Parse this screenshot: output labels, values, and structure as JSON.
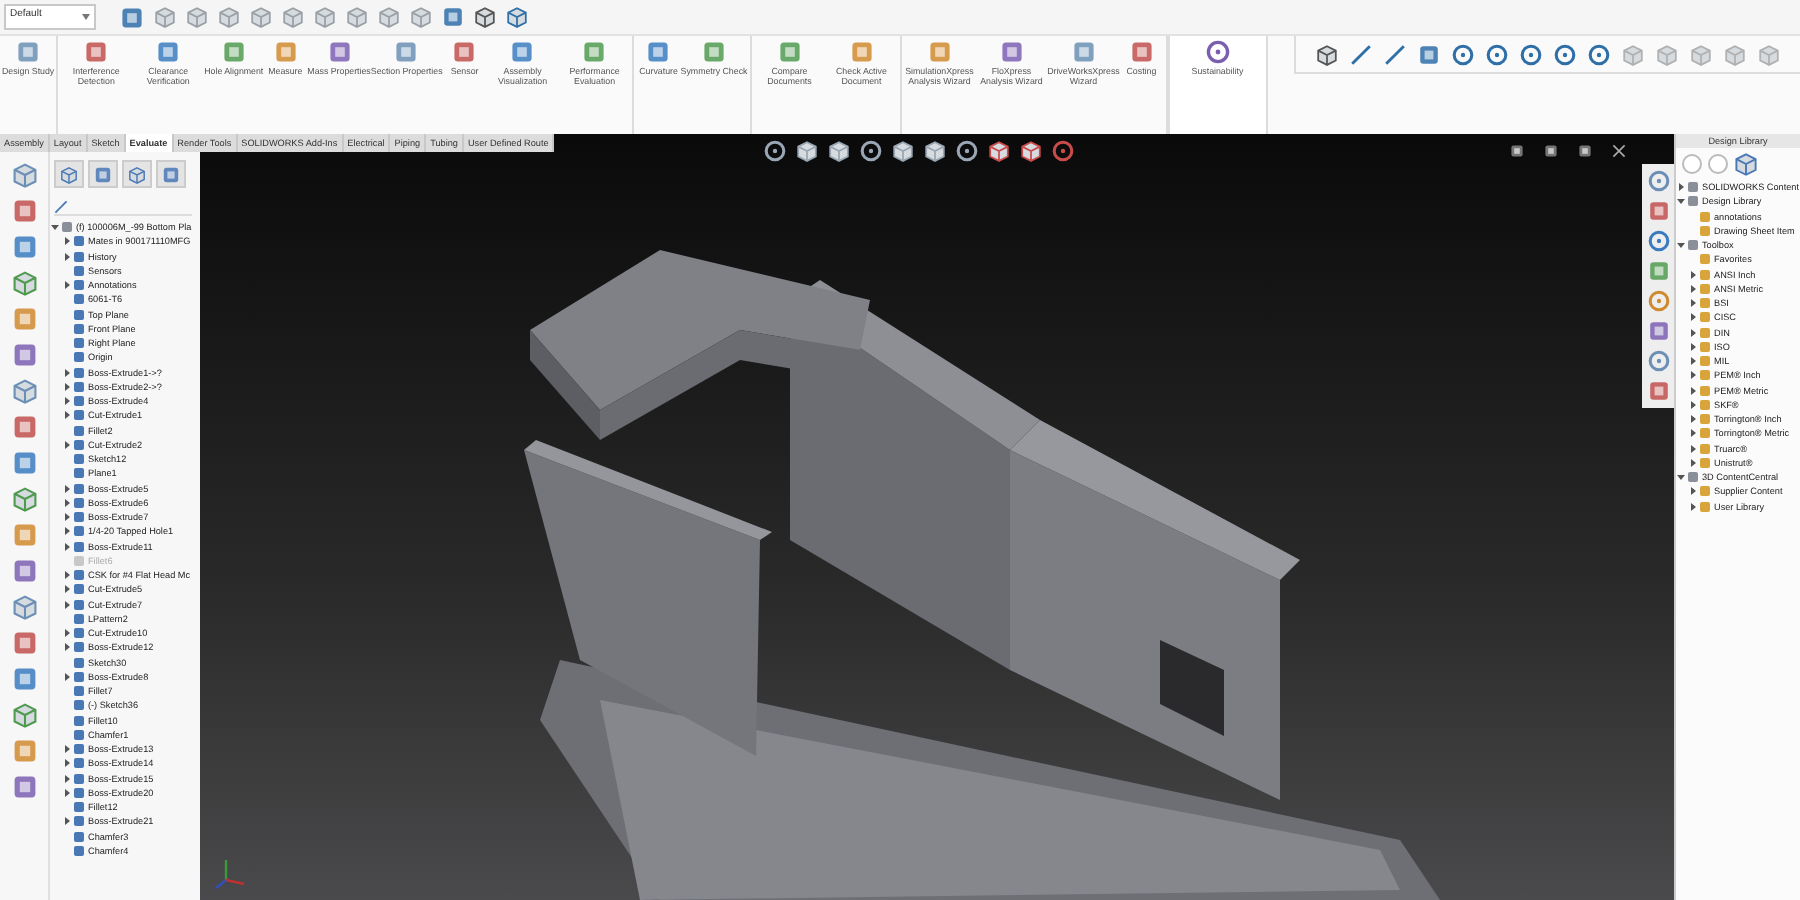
{
  "config_selector": {
    "value": "Default"
  },
  "ribbon": {
    "groups": [
      {
        "highlighted": false,
        "commands": [
          "Design Study"
        ]
      },
      {
        "highlighted": false,
        "commands": [
          "Interference Detection",
          "Clearance Verification",
          "Hole Alignment",
          "Measure",
          "Mass Properties",
          "Section Properties",
          "Sensor",
          "Assembly Visualization",
          "Performance Evaluation"
        ]
      },
      {
        "highlighted": false,
        "commands": [
          "Curvature",
          "Symmetry Check"
        ]
      },
      {
        "highlighted": false,
        "commands": [
          "Compare Documents",
          "Check Active Document"
        ]
      },
      {
        "highlighted": false,
        "commands": [
          "SimulationXpress Analysis Wizard",
          "FloXpress Analysis Wizard",
          "DriveWorksXpress Wizard",
          "Costing"
        ]
      },
      {
        "highlighted": true,
        "commands": [
          "Sustainability"
        ]
      }
    ]
  },
  "command_tabs": [
    {
      "label": "Assembly",
      "selected": false
    },
    {
      "label": "Layout",
      "selected": false
    },
    {
      "label": "Sketch",
      "selected": false
    },
    {
      "label": "Evaluate",
      "selected": true
    },
    {
      "label": "Render Tools",
      "selected": false
    },
    {
      "label": "SOLIDWORKS Add-Ins",
      "selected": false
    },
    {
      "label": "Electrical",
      "selected": false
    },
    {
      "label": "Piping",
      "selected": false
    },
    {
      "label": "Tubing",
      "selected": false
    },
    {
      "label": "User Defined Route",
      "selected": false
    }
  ],
  "feature_tree": {
    "root": {
      "label": "(f) 100006M_-99 Bottom Pla",
      "expanded": true
    },
    "items": [
      {
        "label": "Mates in 900171110MFG",
        "expandable": true,
        "suppressed": false
      },
      {
        "label": "History",
        "expandable": true,
        "suppressed": false
      },
      {
        "label": "Sensors",
        "expandable": false,
        "suppressed": false
      },
      {
        "label": "Annotations",
        "expandable": true,
        "suppressed": false
      },
      {
        "label": "6061-T6",
        "expandable": false,
        "suppressed": false
      },
      {
        "label": "Top Plane",
        "expandable": false,
        "suppressed": false
      },
      {
        "label": "Front Plane",
        "expandable": false,
        "suppressed": false
      },
      {
        "label": "Right Plane",
        "expandable": false,
        "suppressed": false
      },
      {
        "label": "Origin",
        "expandable": false,
        "suppressed": false
      },
      {
        "label": "Boss-Extrude1->?",
        "expandable": true,
        "suppressed": false
      },
      {
        "label": "Boss-Extrude2->?",
        "expandable": true,
        "suppressed": false
      },
      {
        "label": "Boss-Extrude4",
        "expandable": true,
        "suppressed": false
      },
      {
        "label": "Cut-Extrude1",
        "expandable": true,
        "suppressed": false
      },
      {
        "label": "Fillet2",
        "expandable": false,
        "suppressed": false
      },
      {
        "label": "Cut-Extrude2",
        "expandable": true,
        "suppressed": false
      },
      {
        "label": "Sketch12",
        "expandable": false,
        "suppressed": false
      },
      {
        "label": "Plane1",
        "expandable": false,
        "suppressed": false
      },
      {
        "label": "Boss-Extrude5",
        "expandable": true,
        "suppressed": false
      },
      {
        "label": "Boss-Extrude6",
        "expandable": true,
        "suppressed": false
      },
      {
        "label": "Boss-Extrude7",
        "expandable": true,
        "suppressed": false
      },
      {
        "label": "1/4-20 Tapped Hole1",
        "expandable": true,
        "suppressed": false
      },
      {
        "label": "Boss-Extrude11",
        "expandable": true,
        "suppressed": false
      },
      {
        "label": "Fillet6",
        "expandable": false,
        "suppressed": true
      },
      {
        "label": "CSK for #4 Flat Head Mc",
        "expandable": true,
        "suppressed": false
      },
      {
        "label": "Cut-Extrude5",
        "expandable": true,
        "suppressed": false
      },
      {
        "label": "Cut-Extrude7",
        "expandable": true,
        "suppressed": false
      },
      {
        "label": "LPattern2",
        "expandable": false,
        "suppressed": false
      },
      {
        "label": "Cut-Extrude10",
        "expandable": true,
        "suppressed": false
      },
      {
        "label": "Boss-Extrude12",
        "expandable": true,
        "suppressed": false
      },
      {
        "label": "Sketch30",
        "expandable": false,
        "suppressed": false
      },
      {
        "label": "Boss-Extrude8",
        "expandable": true,
        "suppressed": false
      },
      {
        "label": "Fillet7",
        "expandable": false,
        "suppressed": false
      },
      {
        "label": "(-) Sketch36",
        "expandable": false,
        "suppressed": false
      },
      {
        "label": "Fillet10",
        "expandable": false,
        "suppressed": false
      },
      {
        "label": "Chamfer1",
        "expandable": false,
        "suppressed": false
      },
      {
        "label": "Boss-Extrude13",
        "expandable": true,
        "suppressed": false
      },
      {
        "label": "Boss-Extrude14",
        "expandable": true,
        "suppressed": false
      },
      {
        "label": "Boss-Extrude15",
        "expandable": true,
        "suppressed": false
      },
      {
        "label": "Boss-Extrude20",
        "expandable": true,
        "suppressed": false
      },
      {
        "label": "Fillet12",
        "expandable": false,
        "suppressed": false
      },
      {
        "label": "Boss-Extrude21",
        "expandable": true,
        "suppressed": false
      },
      {
        "label": "Chamfer3",
        "expandable": false,
        "suppressed": false
      },
      {
        "label": "Chamfer4",
        "expandable": false,
        "suppressed": false
      }
    ]
  },
  "design_library": {
    "title": "Design Library",
    "items": [
      {
        "label": "SOLIDWORKS Content",
        "expandable": true,
        "expanded": false
      },
      {
        "label": "Design Library",
        "expandable": true,
        "expanded": true,
        "children": [
          {
            "label": "annotations",
            "expandable": false,
            "expanded": false
          },
          {
            "label": "Drawing Sheet Item",
            "expandable": false,
            "expanded": false
          }
        ]
      },
      {
        "label": "Toolbox",
        "expandable": true,
        "expanded": true,
        "children": [
          {
            "label": "Favorites",
            "expandable": false,
            "expanded": false
          },
          {
            "label": "ANSI Inch",
            "expandable": true,
            "expanded": false
          },
          {
            "label": "ANSI Metric",
            "expandable": true,
            "expanded": false
          },
          {
            "label": "BSI",
            "expandable": true,
            "expanded": false
          },
          {
            "label": "CISC",
            "expandable": true,
            "expanded": false
          },
          {
            "label": "DIN",
            "expandable": true,
            "expanded": false
          },
          {
            "label": "ISO",
            "expandable": true,
            "expanded": false
          },
          {
            "label": "MIL",
            "expandable": true,
            "expanded": false
          },
          {
            "label": "PEM® Inch",
            "expandable": true,
            "expanded": false
          },
          {
            "label": "PEM® Metric",
            "expandable": true,
            "expanded": false
          },
          {
            "label": "SKF®",
            "expandable": true,
            "expanded": false
          },
          {
            "label": "Torrington® Inch",
            "expandable": true,
            "expanded": false
          },
          {
            "label": "Torrington® Metric",
            "expandable": true,
            "expanded": false
          },
          {
            "label": "Truarc®",
            "expandable": true,
            "expanded": false
          },
          {
            "label": "Unistrut®",
            "expandable": true,
            "expanded": false
          }
        ]
      },
      {
        "label": "3D ContentCentral",
        "expandable": true,
        "expanded": true,
        "children": [
          {
            "label": "Supplier Content",
            "expandable": true,
            "expanded": false
          },
          {
            "label": "User Library",
            "expandable": true,
            "expanded": false
          }
        ]
      }
    ]
  }
}
